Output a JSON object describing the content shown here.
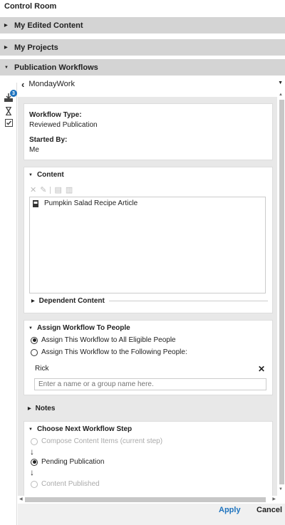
{
  "panel": {
    "title": "Control Room"
  },
  "accordion": [
    {
      "label": "My Edited Content",
      "expanded": false
    },
    {
      "label": "My Projects",
      "expanded": false
    },
    {
      "label": "Publication Workflows",
      "expanded": true
    }
  ],
  "sidebar_icons": [
    "download-icon",
    "hourglass-icon",
    "checkbox-icon"
  ],
  "sidebar_badge": "3",
  "breadcrumb": {
    "label": "MondayWork"
  },
  "workflow": {
    "type_label": "Workflow Type:",
    "type_value": "Reviewed Publication",
    "started_label": "Started By:",
    "started_value": "Me"
  },
  "content": {
    "heading": "Content",
    "toolbar_icons": [
      "close-icon",
      "edit-icon",
      "copy-icon",
      "paste-icon"
    ],
    "items": [
      {
        "title": "Pumpkin Salad Recipe Article",
        "icon": "article-icon"
      }
    ],
    "dependent_label": "Dependent Content"
  },
  "assign": {
    "heading": "Assign Workflow To People",
    "option_all": "Assign This Workflow to All Eligible People",
    "option_following": "Assign This Workflow to the Following People:",
    "selected": "all",
    "person": "Rick",
    "placeholder": "Enter a name or a group name here."
  },
  "notes": {
    "heading": "Notes"
  },
  "next_step": {
    "heading": "Choose Next Workflow Step",
    "steps": [
      {
        "label": "Compose Content Items (current step)",
        "state": "disabled"
      },
      {
        "label": "Pending Publication",
        "state": "selected"
      },
      {
        "label": "Content Published",
        "state": "disabled"
      }
    ]
  },
  "footer": {
    "apply": "Apply",
    "cancel": "Cancel"
  },
  "colors": {
    "accent": "#1e73be",
    "header_bg": "#d4d4d4",
    "content_bg": "#e8e8e8"
  }
}
